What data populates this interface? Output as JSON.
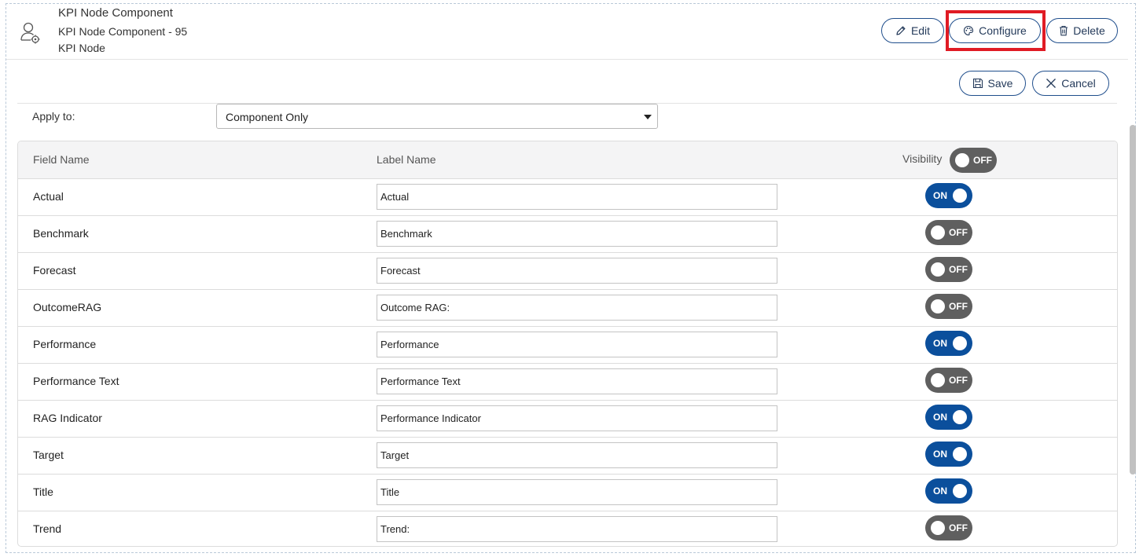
{
  "header": {
    "title": "KPI Node Component",
    "subtitle": "KPI Node Component - 95",
    "type": "KPI Node",
    "edit_label": "Edit",
    "configure_label": "Configure",
    "delete_label": "Delete"
  },
  "actions": {
    "save_label": "Save",
    "cancel_label": "Cancel"
  },
  "apply": {
    "label": "Apply to:",
    "selected": "Component Only"
  },
  "table": {
    "headers": {
      "field": "Field Name",
      "label": "Label Name",
      "visibility": "Visibility"
    },
    "master_toggle": {
      "state": "off",
      "text": "OFF"
    },
    "rows": [
      {
        "field": "Actual",
        "label": "Actual",
        "visible": true,
        "toggle_text": "ON"
      },
      {
        "field": "Benchmark",
        "label": "Benchmark",
        "visible": false,
        "toggle_text": "OFF"
      },
      {
        "field": "Forecast",
        "label": "Forecast",
        "visible": false,
        "toggle_text": "OFF"
      },
      {
        "field": "OutcomeRAG",
        "label": "Outcome RAG:",
        "visible": false,
        "toggle_text": "OFF"
      },
      {
        "field": "Performance",
        "label": "Performance",
        "visible": true,
        "toggle_text": "ON"
      },
      {
        "field": "Performance Text",
        "label": "Performance Text",
        "visible": false,
        "toggle_text": "OFF"
      },
      {
        "field": "RAG Indicator",
        "label": "Performance Indicator",
        "visible": true,
        "toggle_text": "ON"
      },
      {
        "field": "Target",
        "label": "Target",
        "visible": true,
        "toggle_text": "ON"
      },
      {
        "field": "Title",
        "label": "Title",
        "visible": true,
        "toggle_text": "ON"
      },
      {
        "field": "Trend",
        "label": "Trend:",
        "visible": false,
        "toggle_text": "OFF"
      }
    ]
  },
  "icons": {
    "node": "user-gear-icon",
    "edit": "pencil-icon",
    "configure": "palette-icon",
    "delete": "trash-icon",
    "save": "floppy-disk-icon",
    "cancel": "close-icon"
  },
  "colors": {
    "accent": "#0b4f9c",
    "toggle_off": "#5f5f5f",
    "highlight": "#e01b24",
    "button_border": "#1f4e8c"
  }
}
